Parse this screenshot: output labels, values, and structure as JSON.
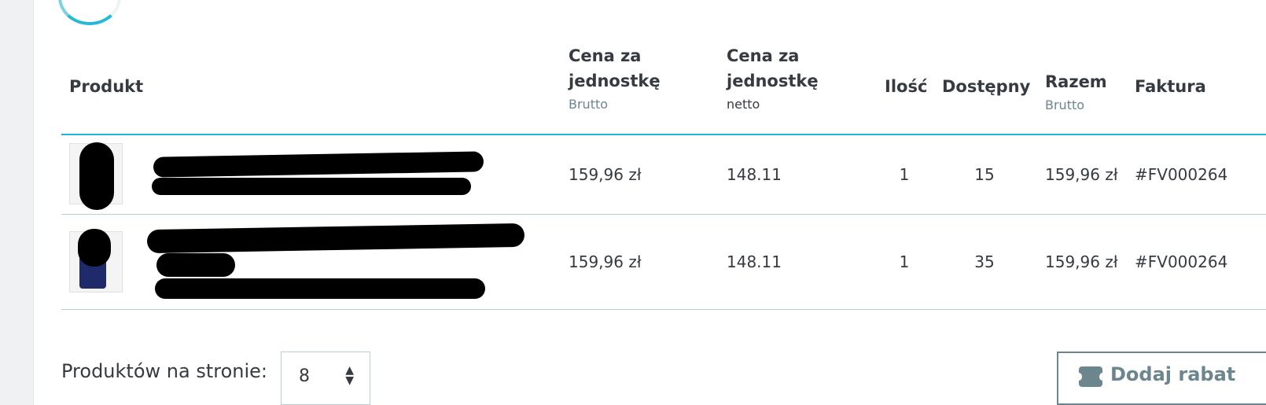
{
  "table": {
    "headers": {
      "product": "Produkt",
      "unit_price_gross": {
        "label": "Cena za jednostkę",
        "sub": "Brutto"
      },
      "unit_price_net": {
        "label": "Cena za jednostkę",
        "sub": "netto"
      },
      "quantity": "Ilość",
      "available": "Dostępny",
      "total": {
        "label": "Razem",
        "sub": "Brutto"
      },
      "invoice": "Faktura"
    },
    "rows": [
      {
        "unit_price_gross": "159,96 zł",
        "unit_price_net": "148.11",
        "quantity": "1",
        "available": "15",
        "total": "159,96 zł",
        "invoice": "#FV000264"
      },
      {
        "unit_price_gross": "159,96 zł",
        "unit_price_net": "148.11",
        "quantity": "1",
        "available": "35",
        "total": "159,96 zł",
        "invoice": "#FV000264"
      }
    ]
  },
  "pagination": {
    "label": "Produktów na stronie:",
    "value": "8"
  },
  "actions": {
    "add_discount": "Dodaj rabat"
  },
  "colors": {
    "accent": "#25b9d7",
    "muted": "#6c868e",
    "text": "#363a41",
    "border": "#bbcdd2"
  }
}
